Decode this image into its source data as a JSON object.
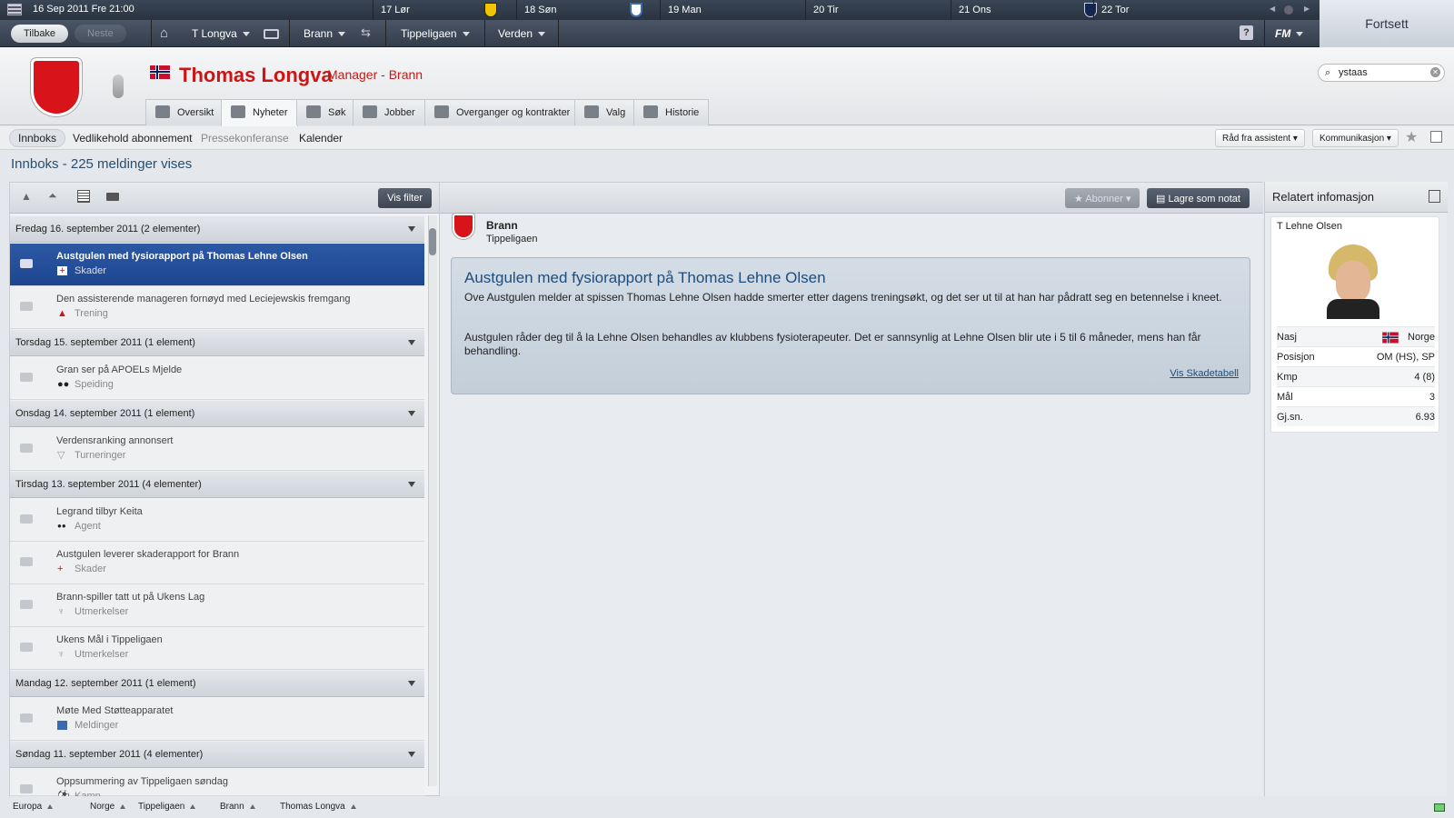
{
  "topbar": {
    "date": "16 Sep 2011 Fre 21:00",
    "calendar": [
      {
        "label": "17 Lør"
      },
      {
        "label": "18 Søn"
      },
      {
        "label": "19 Man"
      },
      {
        "label": "20 Tir"
      },
      {
        "label": "21 Ons"
      },
      {
        "label": "22 Tor"
      }
    ]
  },
  "nav": {
    "back": "Tilbake",
    "next": "Neste",
    "user": "T Longva",
    "club": "Brann",
    "league": "Tippeligaen",
    "world": "Verden",
    "fm": "FM",
    "help": "?"
  },
  "continue": "Fortsett",
  "header": {
    "name": "Thomas Longva",
    "role": "Manager - Brann",
    "search": "ystaas"
  },
  "tabs": [
    "Oversikt",
    "Nyheter",
    "Søk",
    "Jobber",
    "Overganger og kontrakter",
    "Valg",
    "Historie"
  ],
  "subnav": {
    "items": [
      "Innboks",
      "Vedlikehold abonnement",
      "Pressekonferanse",
      "Kalender"
    ],
    "assistant": "Råd fra assistent",
    "communication": "Kommunikasjon"
  },
  "inbox": {
    "title": "Innboks - 225 meldinger vises",
    "filter": "Vis filter",
    "groups": [
      "Fredag 16. september 2011 (2 elementer)",
      "Torsdag 15. september 2011 (1 element)",
      "Onsdag 14. september 2011 (1 element)",
      "Tirsdag 13. september 2011 (4 elementer)",
      "Mandag 12. september 2011 (1 element)",
      "Søndag 11. september 2011 (4 elementer)"
    ],
    "messages": [
      {
        "title": "Austgulen med fysiorapport på Thomas Lehne Olsen",
        "category": "Skader"
      },
      {
        "title": "Den assisterende manageren fornøyd med Leciejewskis fremgang",
        "category": "Trening"
      },
      {
        "title": "Gran ser på APOELs Mjelde",
        "category": "Speiding"
      },
      {
        "title": "Verdensranking annonsert",
        "category": "Turneringer"
      },
      {
        "title": "Legrand tilbyr Keita",
        "category": "Agent"
      },
      {
        "title": "Austgulen leverer skaderapport for Brann",
        "category": "Skader"
      },
      {
        "title": "Brann-spiller tatt ut på Ukens Lag",
        "category": "Utmerkelser"
      },
      {
        "title": "Ukens Mål i Tippeligaen",
        "category": "Utmerkelser"
      },
      {
        "title": "Møte Med Støtteapparatet",
        "category": "Meldinger"
      },
      {
        "title": "Oppsummering av Tippeligaen søndag",
        "category": "Kamp"
      }
    ]
  },
  "detail": {
    "subscribe": "Abonner",
    "save_note": "Lagre som notat",
    "from_club": "Brann",
    "from_league": "Tippeligaen",
    "title": "Austgulen med fysiorapport på Thomas Lehne Olsen",
    "para1": "Ove Austgulen melder at spissen Thomas Lehne Olsen hadde smerter etter dagens treningsøkt, og det ser ut til at han har pådratt seg en betennelse i kneet.",
    "para2": "Austgulen råder deg til å la Lehne Olsen behandles av klubbens fysioterapeuter. Det er sannsynlig at Lehne Olsen blir ute i 5 til 6 måneder, mens han får behandling.",
    "link": "Vis Skadetabell"
  },
  "related": {
    "title": "Relatert infomasjon",
    "player": "T Lehne Olsen",
    "rows": [
      {
        "label": "Nasj",
        "value": "Norge"
      },
      {
        "label": "Posisjon",
        "value": "OM (HS), SP"
      },
      {
        "label": "Kmp",
        "value": "4 (8)"
      },
      {
        "label": "Mål",
        "value": "3"
      },
      {
        "label": "Gj.sn.",
        "value": "6.93"
      }
    ]
  },
  "footer": [
    "Europa",
    "Norge",
    "Tippeligaen",
    "Brann",
    "Thomas Longva"
  ]
}
